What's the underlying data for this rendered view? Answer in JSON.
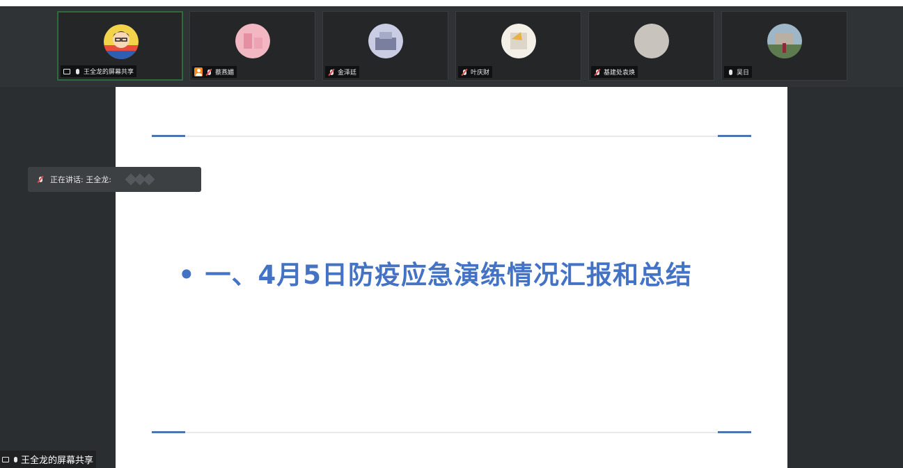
{
  "participants": [
    {
      "name": "王全龙的屏幕共享",
      "status_icons": [
        "screen-share-icon",
        "mic-on-icon"
      ],
      "avatar_colors": [
        "#f3d34a",
        "#e94b3c",
        "#2f5fb0"
      ]
    },
    {
      "name": "蔡燕媚",
      "status_icons": [
        "person-icon",
        "mic-off-icon"
      ],
      "avatar_colors": [
        "#f2b7c3",
        "#e58fa3"
      ]
    },
    {
      "name": "金泽廷",
      "status_icons": [
        "mic-off-icon"
      ],
      "avatar_colors": [
        "#c9cce3",
        "#7a7f9f"
      ]
    },
    {
      "name": "叶庆财",
      "status_icons": [
        "mic-off-icon"
      ],
      "avatar_colors": [
        "#f4f0e8",
        "#e9b04a"
      ]
    },
    {
      "name": "基建处袁焕",
      "status_icons": [
        "mic-off-icon"
      ],
      "avatar_colors": [
        "#c8c4bd",
        "#b8b3ab"
      ]
    },
    {
      "name": "吴日",
      "status_icons": [
        "mic-on-icon"
      ],
      "avatar_colors": [
        "#9db7c9",
        "#5e7a4f"
      ]
    }
  ],
  "speaking_indicator": {
    "label": "正在讲话: 王全龙:"
  },
  "slide": {
    "title": "• 一、4月5日防疫应急演练情况汇报和总结"
  },
  "share_label": {
    "text": "王全龙的屏幕共享"
  },
  "colors": {
    "accent": "#4472c4",
    "background": "#2b2e30"
  }
}
